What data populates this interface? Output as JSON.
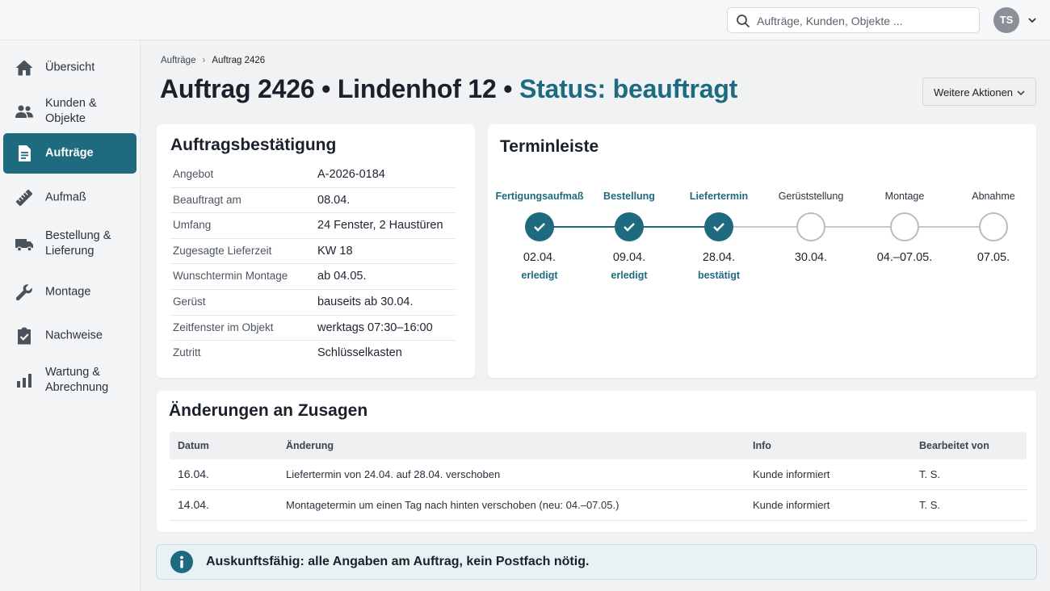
{
  "header": {
    "search_placeholder": "Aufträge, Kunden, Objekte ...",
    "avatar_initials": "TS"
  },
  "sidebar": {
    "items": [
      {
        "label": "Übersicht",
        "icon": "home-icon"
      },
      {
        "label": "Kunden & Objekte",
        "icon": "users-icon"
      },
      {
        "label": "Aufträge",
        "icon": "document-icon",
        "active": true
      },
      {
        "label": "Aufmaß",
        "icon": "ruler-icon"
      },
      {
        "label": "Bestellung & Lieferung",
        "icon": "truck-icon"
      },
      {
        "label": "Montage",
        "icon": "wrench-icon"
      },
      {
        "label": "Nachweise",
        "icon": "clipboard-check-icon"
      },
      {
        "label": "Wartung & Abrechnung",
        "icon": "bar-chart-icon"
      }
    ]
  },
  "breadcrumb": {
    "parent": "Aufträge",
    "current": "Auftrag 2426"
  },
  "page": {
    "title_main": "Auftrag 2426 • Lindenhof 12 • ",
    "title_status": "Status: beauftragt",
    "more_actions": "Weitere Aktionen"
  },
  "confirmation": {
    "title": "Auftragsbestätigung",
    "rows": [
      {
        "key": "Angebot",
        "value": "A-2026-0184"
      },
      {
        "key": "Beauftragt am",
        "value": "08.04."
      },
      {
        "key": "Umfang",
        "value": "24 Fenster, 2 Haustüren"
      },
      {
        "key": "Zugesagte Lieferzeit",
        "value": "KW 18"
      },
      {
        "key": "Wunschtermin Montage",
        "value": "ab 04.05."
      },
      {
        "key": "Gerüst",
        "value": "bauseits ab 30.04."
      },
      {
        "key": "Zeitfenster im Objekt",
        "value": "werktags 07:30–16:00"
      },
      {
        "key": "Zutritt",
        "value": "Schlüsselkasten"
      }
    ]
  },
  "timeline": {
    "title": "Terminleiste",
    "steps": [
      {
        "label": "Fertigungsaufmaß",
        "date": "02.04.",
        "state": "erledigt",
        "done": true
      },
      {
        "label": "Bestellung",
        "date": "09.04.",
        "state": "erledigt",
        "done": true
      },
      {
        "label": "Liefertermin",
        "date": "28.04.",
        "state": "bestätigt",
        "done": true
      },
      {
        "label": "Gerüststellung",
        "date": "30.04.",
        "state": "",
        "done": false
      },
      {
        "label": "Montage",
        "date": "04.–07.05.",
        "state": "",
        "done": false
      },
      {
        "label": "Abnahme",
        "date": "07.05.",
        "state": "",
        "done": false
      }
    ],
    "colors": {
      "done": "#1e6b80",
      "open": "#b8bcc2"
    }
  },
  "changes": {
    "title": "Änderungen an Zusagen",
    "columns": {
      "date": "Datum",
      "change": "Änderung",
      "info": "Info",
      "editor": "Bearbeitet von"
    },
    "rows": [
      {
        "date": "16.04.",
        "change": "Liefertermin von 24.04. auf 28.04. verschoben",
        "info": "Kunde informiert",
        "editor": "T. S."
      },
      {
        "date": "14.04.",
        "change": "Montagetermin um einen Tag nach hinten verschoben (neu: 04.–07.05.)",
        "info": "Kunde informiert",
        "editor": "T. S."
      }
    ]
  },
  "info_banner": {
    "text": "Auskunftsfähig: alle Angaben am Auftrag, kein Postfach nötig.",
    "icon": "info-icon"
  },
  "theme": {
    "accent": "#1e6b80"
  }
}
